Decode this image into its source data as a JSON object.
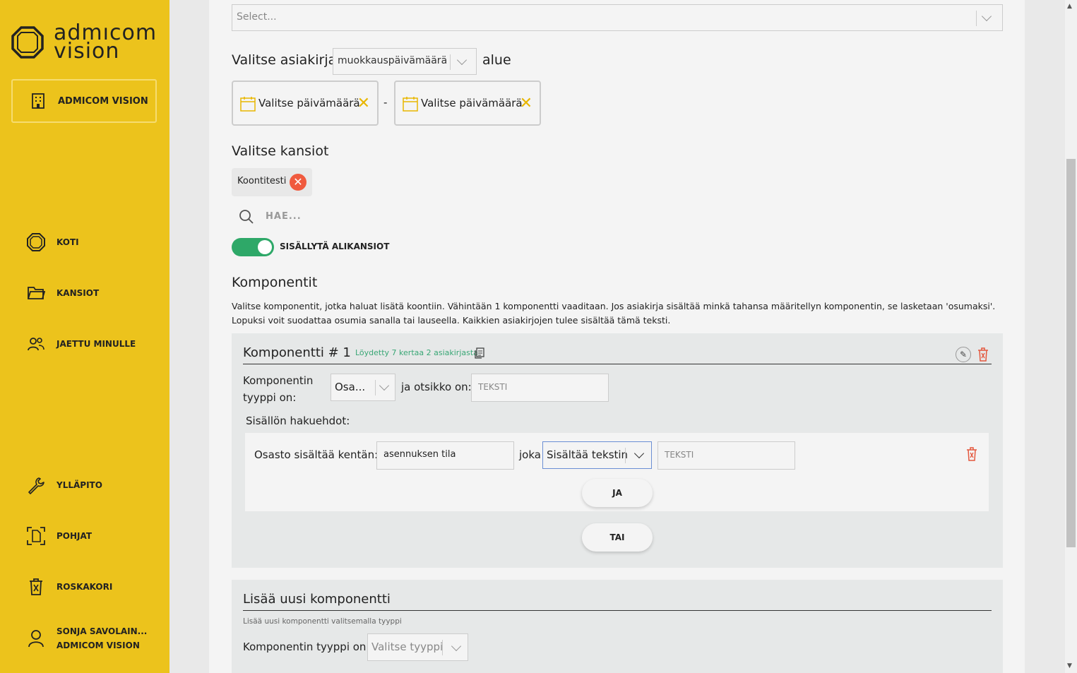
{
  "sidebar": {
    "logo_line1": "admıcom",
    "logo_line2": "vision",
    "org_button": "ADMICOM VISION",
    "nav": [
      {
        "label": "KOTI",
        "icon": "home-octagon-icon"
      },
      {
        "label": "KANSIOT",
        "icon": "folder-icon"
      },
      {
        "label": "JAETTU MINULLE",
        "icon": "users-icon"
      },
      {
        "label": "YLLÄPITO",
        "icon": "wrench-icon"
      },
      {
        "label": "POHJAT",
        "icon": "template-icon"
      },
      {
        "label": "ROSKAKORI",
        "icon": "trash-icon"
      }
    ],
    "user": {
      "name": "SONJA SAVOLAIN...",
      "org": "ADMICOM VISION",
      "icon": "user-icon"
    }
  },
  "top_select": {
    "placeholder": "Select..."
  },
  "document_range": {
    "prefix": "Valitse asiakirja",
    "field": "muokkauspäivämäärä",
    "suffix": "alue",
    "start_placeholder": "Valitse päivämäärä",
    "separator": "-",
    "end_placeholder": "Valitse päivämäärä"
  },
  "folders": {
    "heading": "Valitse kansiot",
    "selected": [
      "Koontitesti"
    ],
    "search_placeholder": "HAE...",
    "include_subfolders_label": "SISÄLLYTÄ ALIKANSIOT",
    "include_subfolders": true
  },
  "components": {
    "heading": "Komponentit",
    "description_line1": "Valitse komponentit, jotka haluat lisätä koontiin. Vähintään 1 komponentti vaaditaan. Jos asiakirja sisältää minkä tahansa määritellyn komponentin, se lasketaan 'osumaksi'.",
    "description_line2": "Lopuksi voit suodattaa osumia sanalla tai lauseella. Kaikkien asiakirjojen tulee sisältää tämä teksti.",
    "items": [
      {
        "title": "Komponentti # 1",
        "found_text": "Löydetty 7 kertaa 2 asiakirjasta",
        "type_label_1": "Komponentin",
        "type_label_2": "tyyppi on:",
        "type_value": "Osa...",
        "title_label": "ja otsikko on:",
        "title_placeholder": "TEKSTI",
        "criteria_heading": "Sisällön hakuehdot:",
        "condition": {
          "field_label": "Osasto sisältää kentän:",
          "field_value": "asennuksen tila",
          "joiner": "joka",
          "operator": "Sisältää tekstin",
          "value_placeholder": "TEKSTI"
        },
        "and_button": "JA",
        "or_button": "TAI"
      }
    ]
  },
  "add_component": {
    "title": "Lisää uusi komponentti",
    "hint": "Lisää uusi komponentti valitsemalla tyyppi",
    "type_label": "Komponentin tyyppi on:",
    "type_placeholder": "Valitse tyyppi"
  },
  "colors": {
    "sidebar": "#ecc31c",
    "accent_yellow": "#e8b600",
    "toggle_green": "#2ea868",
    "danger": "#f05a3e",
    "found_green": "#3aa776"
  }
}
